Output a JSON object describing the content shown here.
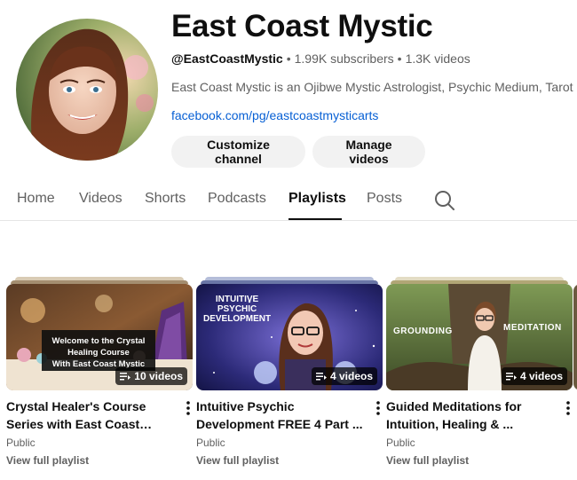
{
  "channel": {
    "name": "East Coast Mystic",
    "handle": "@EastCoastMystic",
    "subscribers": "1.99K subscribers",
    "videos": "1.3K videos",
    "separator": "•",
    "description": "East Coast Mystic is an Ojibwe Mystic Astrologist,  Psychic Medium, Tarot",
    "link": "facebook.com/pg/eastcoastmysticarts"
  },
  "buttons": {
    "customize": "Customize channel",
    "manage": "Manage videos"
  },
  "tabs": [
    {
      "label": "Home"
    },
    {
      "label": "Videos"
    },
    {
      "label": "Shorts"
    },
    {
      "label": "Podcasts"
    },
    {
      "label": "Playlists",
      "active": true
    },
    {
      "label": "Posts"
    }
  ],
  "playlists": [
    {
      "title": "Crystal Healer's Course Series with East Coast Mystic",
      "count": "10 videos",
      "visibility": "Public",
      "view_full": "View full playlist",
      "overlay_text": [
        "Welcome to the Crystal",
        "Healing Course",
        "With East Coast Mystic"
      ]
    },
    {
      "title": "Intuitive Psychic Development FREE 4 Part ...",
      "count": "4 videos",
      "visibility": "Public",
      "view_full": "View full playlist",
      "overlay_text": [
        "INTUITIVE",
        "PSYCHIC",
        "DEVELOPMENT"
      ]
    },
    {
      "title": "Guided Meditations for Intuition, Healing & ...",
      "count": "4 videos",
      "visibility": "Public",
      "view_full": "View full playlist",
      "overlay_text": [
        "GROUNDING",
        "MEDITATION"
      ]
    }
  ],
  "icons": {
    "search": "search-icon",
    "kebab": "more-vert-icon",
    "playlist": "playlist-icon"
  },
  "colors": {
    "link": "#065fd4",
    "button_bg": "#f2f2f2",
    "muted_text": "#606060"
  }
}
